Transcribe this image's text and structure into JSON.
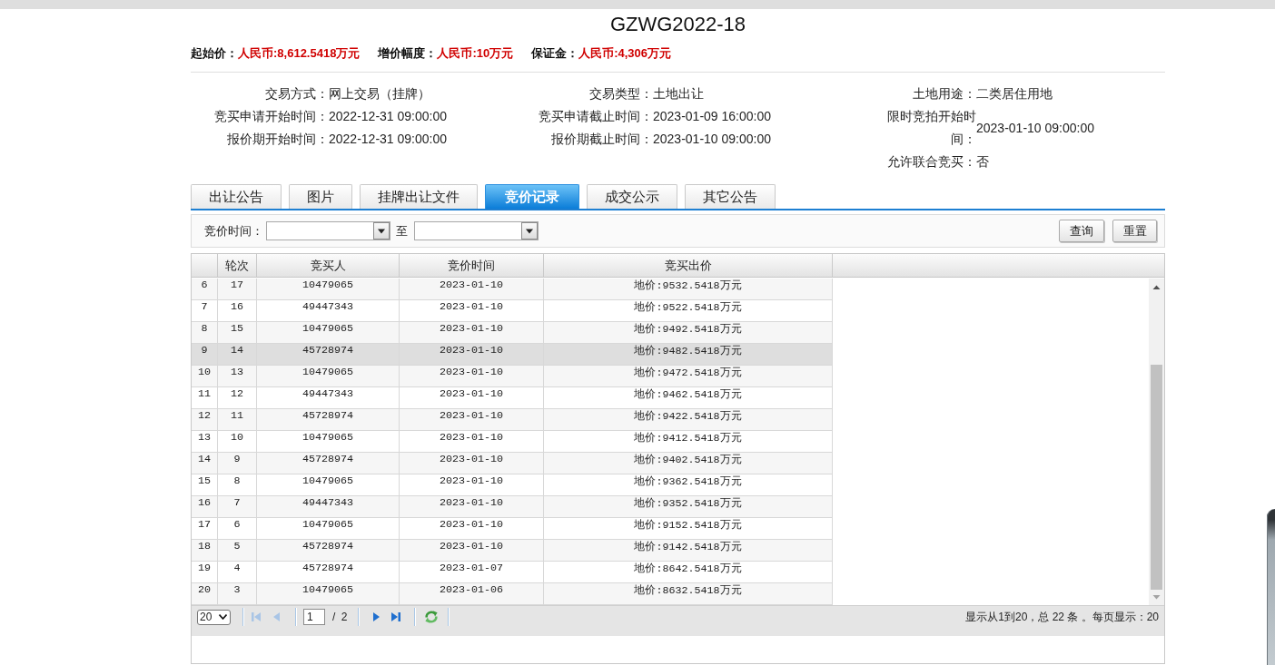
{
  "header": {
    "title": "GZWG2022-18",
    "prices": [
      {
        "label": "起始价：",
        "value": "人民币:8,612.5418万元"
      },
      {
        "label": "增价幅度：",
        "value": "人民币:10万元"
      },
      {
        "label": "保证金：",
        "value": "人民币:4,306万元"
      }
    ]
  },
  "details": {
    "columns": [
      [
        {
          "label": "交易方式：",
          "value": "网上交易（挂牌）"
        },
        {
          "label": "竞买申请开始时间：",
          "value": "2022-12-31 09:00:00"
        },
        {
          "label": "报价期开始时间：",
          "value": "2022-12-31 09:00:00"
        }
      ],
      [
        {
          "label": "交易类型：",
          "value": "土地出让"
        },
        {
          "label": "竞买申请截止时间：",
          "value": "2023-01-09 16:00:00"
        },
        {
          "label": "报价期截止时间：",
          "value": "2023-01-10 09:00:00"
        }
      ],
      [
        {
          "label": "土地用途：",
          "value": "二类居住用地"
        },
        {
          "label": "限时竞拍开始时间：",
          "value": "2023-01-10 09:00:00"
        },
        {
          "label": "允许联合竞买：",
          "value": "否"
        }
      ]
    ]
  },
  "tabs": [
    {
      "label": "出让公告",
      "selected": false
    },
    {
      "label": "图片",
      "selected": false
    },
    {
      "label": "挂牌出让文件",
      "selected": false
    },
    {
      "label": "竞价记录",
      "selected": true
    },
    {
      "label": "成交公示",
      "selected": false
    },
    {
      "label": "其它公告",
      "selected": false
    }
  ],
  "filter": {
    "label": "竞价时间：",
    "range_separator": "至",
    "buttons": [
      "查询",
      "重置"
    ]
  },
  "table": {
    "columns": [
      "轮次",
      "竞买人",
      "竞价时间",
      "竞买出价"
    ],
    "rows": [
      {
        "number": "6",
        "cells": [
          "17",
          "10479065",
          "2023-01-10",
          "地价:9532.5418万元"
        ],
        "selected": false
      },
      {
        "number": "7",
        "cells": [
          "16",
          "49447343",
          "2023-01-10",
          "地价:9522.5418万元"
        ],
        "selected": false
      },
      {
        "number": "8",
        "cells": [
          "15",
          "10479065",
          "2023-01-10",
          "地价:9492.5418万元"
        ],
        "selected": false
      },
      {
        "number": "9",
        "cells": [
          "14",
          "45728974",
          "2023-01-10",
          "地价:9482.5418万元"
        ],
        "selected": true
      },
      {
        "number": "10",
        "cells": [
          "13",
          "10479065",
          "2023-01-10",
          "地价:9472.5418万元"
        ],
        "selected": false
      },
      {
        "number": "11",
        "cells": [
          "12",
          "49447343",
          "2023-01-10",
          "地价:9462.5418万元"
        ],
        "selected": false
      },
      {
        "number": "12",
        "cells": [
          "11",
          "45728974",
          "2023-01-10",
          "地价:9422.5418万元"
        ],
        "selected": false
      },
      {
        "number": "13",
        "cells": [
          "10",
          "10479065",
          "2023-01-10",
          "地价:9412.5418万元"
        ],
        "selected": false
      },
      {
        "number": "14",
        "cells": [
          "9",
          "45728974",
          "2023-01-10",
          "地价:9402.5418万元"
        ],
        "selected": false
      },
      {
        "number": "15",
        "cells": [
          "8",
          "10479065",
          "2023-01-10",
          "地价:9362.5418万元"
        ],
        "selected": false
      },
      {
        "number": "16",
        "cells": [
          "7",
          "49447343",
          "2023-01-10",
          "地价:9352.5418万元"
        ],
        "selected": false
      },
      {
        "number": "17",
        "cells": [
          "6",
          "10479065",
          "2023-01-10",
          "地价:9152.5418万元"
        ],
        "selected": false
      },
      {
        "number": "18",
        "cells": [
          "5",
          "45728974",
          "2023-01-10",
          "地价:9142.5418万元"
        ],
        "selected": false
      },
      {
        "number": "19",
        "cells": [
          "4",
          "45728974",
          "2023-01-07",
          "地价:8642.5418万元"
        ],
        "selected": false
      },
      {
        "number": "20",
        "cells": [
          "3",
          "10479065",
          "2023-01-06",
          "地价:8632.5418万元"
        ],
        "selected": false
      }
    ]
  },
  "pagination": {
    "page_size": "20",
    "nav_buttons": [
      {
        "kind": "first",
        "disabled": true
      },
      {
        "kind": "prev",
        "disabled": true
      },
      {
        "kind": "next",
        "disabled": false
      },
      {
        "kind": "last",
        "disabled": false
      }
    ],
    "page": "1",
    "page_count": "/ 2",
    "status": "显示从1到20，总 22 条 。每页显示：20"
  }
}
